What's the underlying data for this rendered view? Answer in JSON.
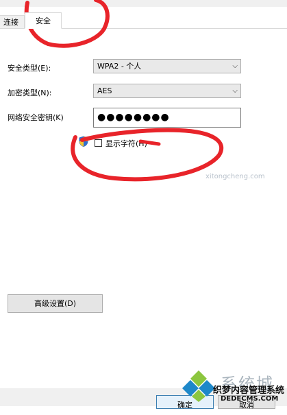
{
  "tabs": [
    {
      "label": "连接",
      "active": false
    },
    {
      "label": "安全",
      "active": true
    }
  ],
  "form": {
    "security_type": {
      "label": "安全类型(E):",
      "value": "WPA2 - 个人"
    },
    "encryption_type": {
      "label": "加密类型(N):",
      "value": "AES"
    },
    "network_key": {
      "label": "网络安全密钥(K)",
      "value": "●●●●●●●●"
    },
    "show_chars": {
      "label": "显示字符(H)",
      "checked": false
    }
  },
  "buttons": {
    "advanced": "高级设置(D)",
    "ok": "确定",
    "cancel": "取消"
  },
  "watermark": {
    "site": "系统城",
    "brand": "织梦内容管理系统",
    "domain": "DEDECMS.COM",
    "url": "xitongcheng.com"
  },
  "colors": {
    "annotation": "#e8242a",
    "accent": "#3c7fb1"
  }
}
